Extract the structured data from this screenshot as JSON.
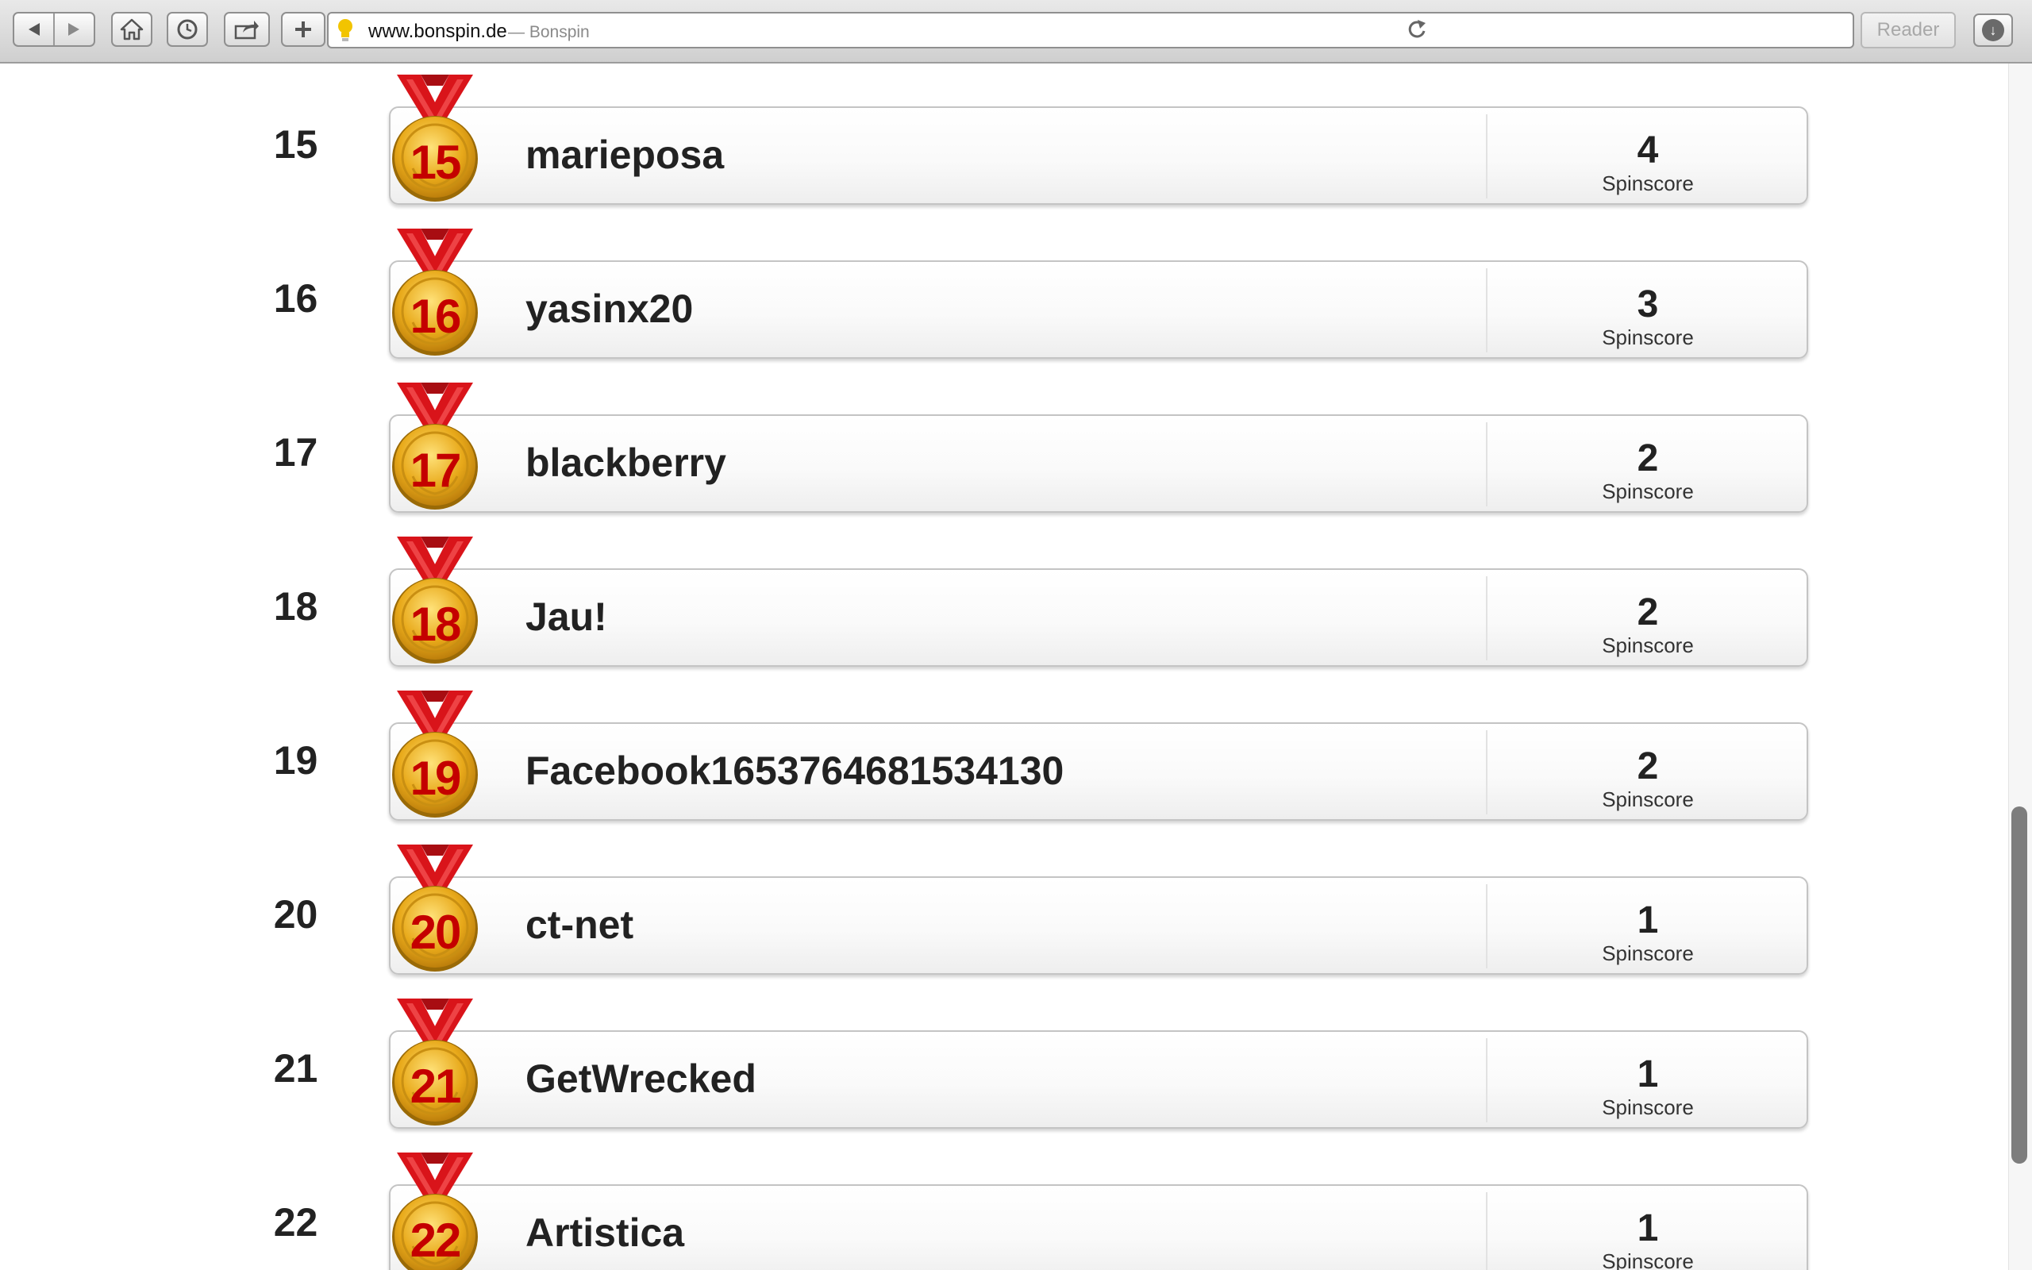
{
  "browser": {
    "url": "www.bonspin.de",
    "title_sep": "—",
    "page_title": "Bonspin",
    "reader_label": "Reader",
    "icons": {
      "back": "back-arrow-icon",
      "forward": "forward-arrow-icon",
      "home": "home-icon",
      "history": "clock-icon",
      "share": "share-icon",
      "new_tab": "plus-icon",
      "site": "lightbulb-icon",
      "reload": "reload-icon",
      "downloads": "download-icon"
    }
  },
  "leaderboard": {
    "score_label": "Spinscore",
    "colors": {
      "medal_gold": "#e8a91a",
      "ribbon_red": "#d9141a",
      "number_red": "#c40000"
    },
    "rows": [
      {
        "rank": "15",
        "name": "marieposa",
        "score": "4"
      },
      {
        "rank": "16",
        "name": "yasinx20",
        "score": "3"
      },
      {
        "rank": "17",
        "name": "blackberry",
        "score": "2"
      },
      {
        "rank": "18",
        "name": "Jau!",
        "score": "2"
      },
      {
        "rank": "19",
        "name": "Facebook1653764681534130",
        "score": "2"
      },
      {
        "rank": "20",
        "name": "ct-net",
        "score": "1"
      },
      {
        "rank": "21",
        "name": "GetWrecked",
        "score": "1"
      },
      {
        "rank": "22",
        "name": "Artistica",
        "score": "1"
      }
    ]
  }
}
